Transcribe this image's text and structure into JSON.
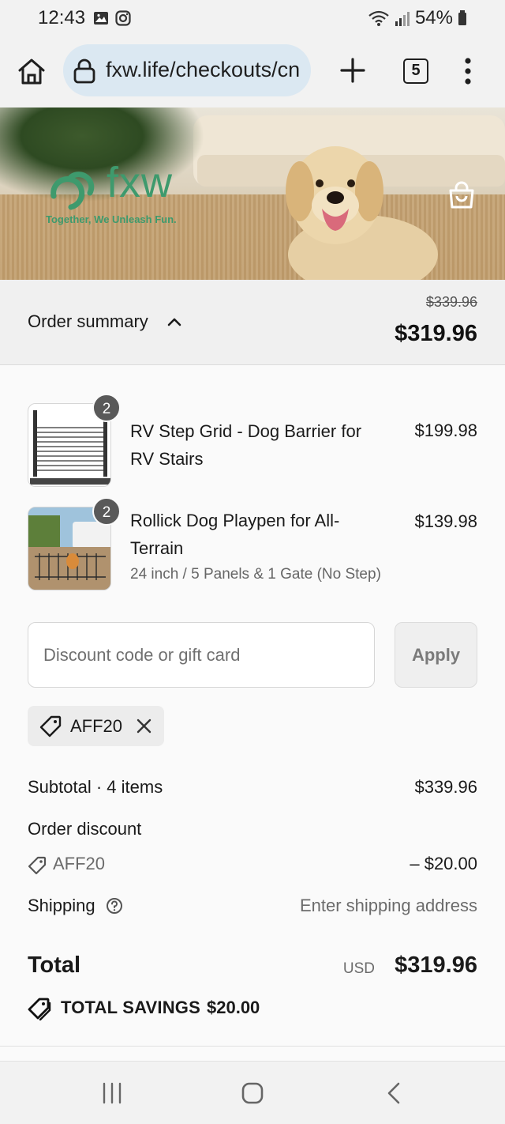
{
  "status_bar": {
    "time": "12:43",
    "battery": "54%"
  },
  "browser": {
    "url": "fxw.life/checkouts/cn",
    "tab_count": "5"
  },
  "banner": {
    "logo_text": "fxw",
    "tagline": "Together, We Unleash Fun."
  },
  "summary": {
    "label": "Order summary",
    "original_price": "$339.96",
    "total": "$319.96"
  },
  "items": [
    {
      "name": "RV Step Grid - Dog Barrier for RV Stairs",
      "variant": "",
      "price": "$199.98",
      "quantity": "2"
    },
    {
      "name": "Rollick Dog Playpen for All-Terrain",
      "variant": "24 inch / 5 Panels & 1 Gate (No Step)",
      "price": "$139.98",
      "quantity": "2"
    }
  ],
  "discount": {
    "placeholder": "Discount code or gift card",
    "apply_label": "Apply",
    "applied_code": "AFF20"
  },
  "costs": {
    "subtotal_label": "Subtotal · 4 items",
    "subtotal_value": "$339.96",
    "discount_label": "Order discount",
    "discount_code": "AFF20",
    "discount_value": "– $20.00",
    "shipping_label": "Shipping",
    "shipping_value": "Enter shipping address",
    "total_label": "Total",
    "currency": "USD",
    "total_value": "$319.96",
    "savings_label": "TOTAL SAVINGS",
    "savings_value": "$20.00"
  },
  "colors": {
    "brand_green": "#3e9a6d",
    "url_bar": "#dbe8f2"
  }
}
